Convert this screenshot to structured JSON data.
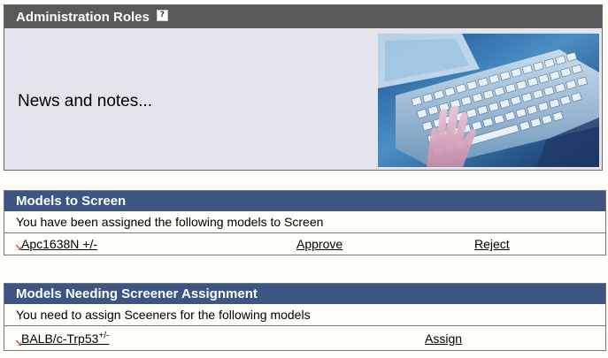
{
  "admin": {
    "title": "Administration Roles",
    "help_glyph": "?",
    "news_text": "News and notes..."
  },
  "screen_panel": {
    "title": "Models to Screen",
    "message": "You have been assigned the following models to Screen",
    "rows": [
      {
        "model": "Apc1638N +/-",
        "approve": "Approve",
        "reject": "Reject"
      }
    ]
  },
  "assign_panel": {
    "title": "Models Needing Screener Assignment",
    "message": "You need to assign Sceeners for the following models",
    "rows": [
      {
        "model": "BALB/c-Trp53",
        "model_sup": "+/-",
        "assign": "Assign"
      }
    ]
  },
  "icons": {
    "help": "help-icon",
    "bullet": "red-arrow-bullet-icon",
    "hero": "keyboard-typing-photo"
  },
  "colors": {
    "admin_header": "#595959",
    "panel_header": "#3c5582",
    "news_background": "#e4e4ec",
    "page_background": "#fffdf7",
    "bullet": "#c0392b"
  }
}
